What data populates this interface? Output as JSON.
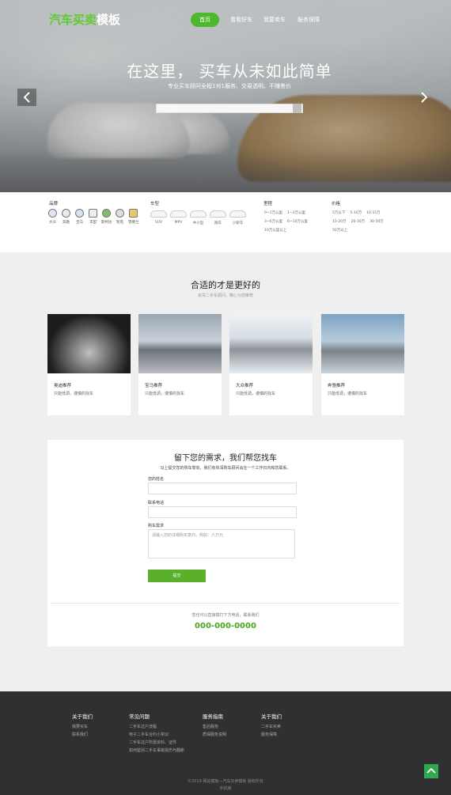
{
  "header": {
    "logo_part1": "汽车买卖",
    "logo_part2": "模板",
    "nav": [
      "首页",
      "看看好车",
      "我要卖车",
      "服务保障"
    ]
  },
  "hero": {
    "title": "在这里， 买车从未如此简单",
    "subtitle": "专业买车顾问全程1对1服务、交易透明、不赚差价"
  },
  "filters": {
    "brand_label": "品牌",
    "brands": [
      "大众",
      "奔驰",
      "宝马",
      "丰田",
      "斯柯达",
      "别克",
      "雪佛兰"
    ],
    "type_label": "车型",
    "types": [
      "SUV",
      "MPV",
      "中小型",
      "跑车",
      "小轿车"
    ],
    "mileage_label": "里程",
    "mileage": [
      "0~1万公里",
      "1~3万公里",
      "3~6万公里",
      "6~10万公里",
      "10万公里以上"
    ],
    "price_label": "价格",
    "price": [
      "5万以下",
      "5-10万",
      "10-15万",
      "15-20万",
      "20-30万",
      "30-50万",
      "50万以上"
    ]
  },
  "recommend": {
    "title": "合适的才是更好的",
    "subtitle": "资深二手车顾问，精心为您推荐",
    "cards": [
      {
        "title": "奥迪推荐",
        "desc": "只能低调，谨慎的找车"
      },
      {
        "title": "宝马推荐",
        "desc": "只能低调，谨慎的找车"
      },
      {
        "title": "大众推荐",
        "desc": "只能低调，谨慎的找车"
      },
      {
        "title": "奔驰推荐",
        "desc": "只能低调，谨慎的找车"
      }
    ]
  },
  "form": {
    "title": "留下您的需求，我们帮您找车",
    "subtitle": "马上提交您的购车意向，我们有资深购车顾问会在一个工作日内和您联系。",
    "name_label": "您的姓名",
    "phone_label": "联系电话",
    "need_label": "购车需求",
    "need_placeholder": "请输入您的详细购买意向，例如：六万元",
    "submit": "提交",
    "call_text": "您也可以直接拨打下方电话，联系我们",
    "phone": "000-000-0000"
  },
  "footer": {
    "columns": [
      {
        "title": "关于我们",
        "links": [
          "我要买车",
          "联系我们"
        ]
      },
      {
        "title": "常见问题",
        "links": [
          "二手车过户流程",
          "电子二手车合约小常识",
          "二手车过户所需资料、证件",
          "如何鉴别二手车事故损伤与翻新"
        ]
      },
      {
        "title": "服务指南",
        "links": [
          "售后服务",
          "质保服务说明"
        ]
      },
      {
        "title": "关于我们",
        "links": [
          "二手车买卖",
          "服务保障"
        ]
      }
    ],
    "copyright": "©2019 网站模板—汽车买卖模板 版权所有",
    "mobile": "手机版"
  },
  "colors": {
    "accent_green": "#4cb82c",
    "footer_bg": "#2f3031",
    "phone_green": "#4aa51f"
  },
  "icons": [
    "arrow-left-icon",
    "arrow-right-icon",
    "search-icon",
    "back-to-top-icon"
  ]
}
